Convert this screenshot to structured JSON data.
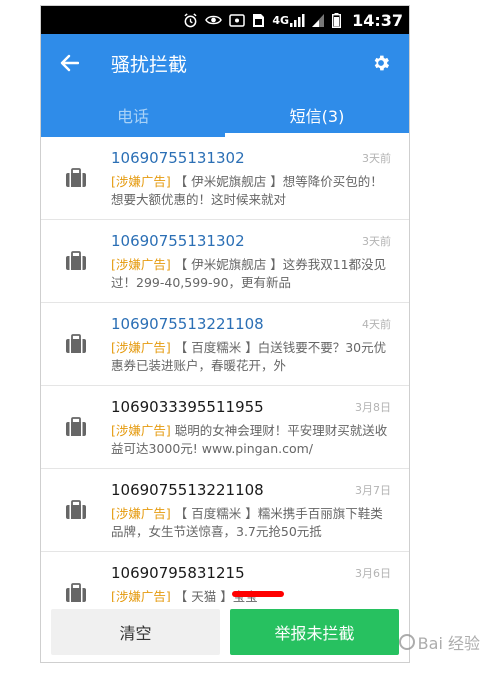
{
  "status": {
    "network": "4G",
    "time": "14:37"
  },
  "appbar": {
    "title": "骚扰拦截"
  },
  "tabs": [
    {
      "label": "电话",
      "active": false
    },
    {
      "label": "短信(3)",
      "active": true
    }
  ],
  "messages": [
    {
      "number": "10690755131302",
      "date": "3天前",
      "tag": "[涉嫌广告]",
      "text": "【 伊米妮旗舰店 】想等降价买包的！想要大额优惠的！这时候来就对",
      "unread": true
    },
    {
      "number": "10690755131302",
      "date": "3天前",
      "tag": "[涉嫌广告]",
      "text": "【 伊米妮旗舰店 】这券我双11都没见过！299-40,599-90，更有新品",
      "unread": true
    },
    {
      "number": "1069075513221108",
      "date": "4天前",
      "tag": "[涉嫌广告]",
      "text": "【 百度糯米 】白送钱要不要？30元优惠券已装进账户，春暖花开，外",
      "unread": true
    },
    {
      "number": "1069033395511955",
      "date": "3月8日",
      "tag": "[涉嫌广告]",
      "text": "聪明的女神会理财！平安理财买就送收益可达3000元! www.pingan.com/",
      "unread": false
    },
    {
      "number": "1069075513221108",
      "date": "3月7日",
      "tag": "[涉嫌广告]",
      "text": "【 百度糯米 】糯米携手百丽旗下鞋类品牌，女生节送惊喜，3.7元抢50元抵",
      "unread": false
    },
    {
      "number": "10690795831215",
      "date": "3月6日",
      "tag": "[涉嫌广告]",
      "text": "【 天猫 】宝宝",
      "unread": false
    }
  ],
  "buttons": {
    "clear": "清空",
    "report": "举报未拦截"
  },
  "watermark": "Bai 经验",
  "colors": {
    "accent": "#2f8ce9",
    "report": "#27c160",
    "tag": "#e59b10"
  }
}
